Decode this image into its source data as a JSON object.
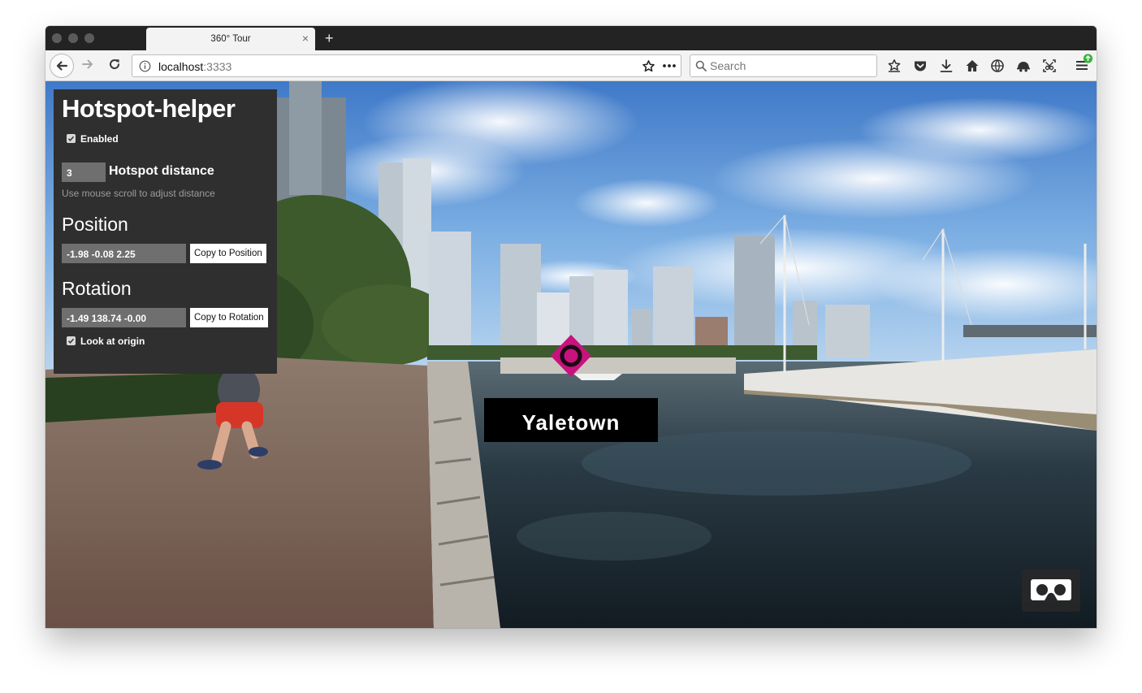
{
  "browser": {
    "tab_title": "360° Tour",
    "tab_close_glyph": "×",
    "new_tab_glyph": "+",
    "url_host": "localhost",
    "url_port": ":3333",
    "search_placeholder": "Search",
    "icons": [
      "back-icon",
      "forward-icon",
      "reload-icon",
      "info-icon",
      "bookmark-star-icon",
      "page-actions-icon",
      "search-icon",
      "bookmarks-library-icon",
      "pocket-icon",
      "download-icon",
      "home-icon",
      "vpn-globe-icon",
      "private-mask-icon",
      "screenshot-icon",
      "menu-icon"
    ],
    "colors": {
      "tab_strip": "#232323",
      "toolbar": "#f3f3f3",
      "update_badge": "#34b53a"
    }
  },
  "hotspot_helper": {
    "title": "Hotspot-helper",
    "enabled_label": "Enabled",
    "enabled": true,
    "distance_value": "3",
    "distance_label": "Hotspot distance",
    "hint": "Use mouse scroll to adjust distance",
    "position_title": "Position",
    "position_value": "-1.98 -0.08 2.25",
    "copy_position_label": "Copy to Position",
    "rotation_title": "Rotation",
    "rotation_value": "-1.49 138.74 -0.00",
    "copy_rotation_label": "Copy to Rotation",
    "look_at_origin_label": "Look at origin",
    "look_at_origin": true,
    "colors": {
      "panel_bg": "#2f2f2f",
      "field_bg": "#6f6f6f"
    }
  },
  "scene": {
    "hotspot_label": "Yaletown",
    "hotspot_color": "#c8127e",
    "vr_button_icon": "vr-goggles-icon"
  }
}
